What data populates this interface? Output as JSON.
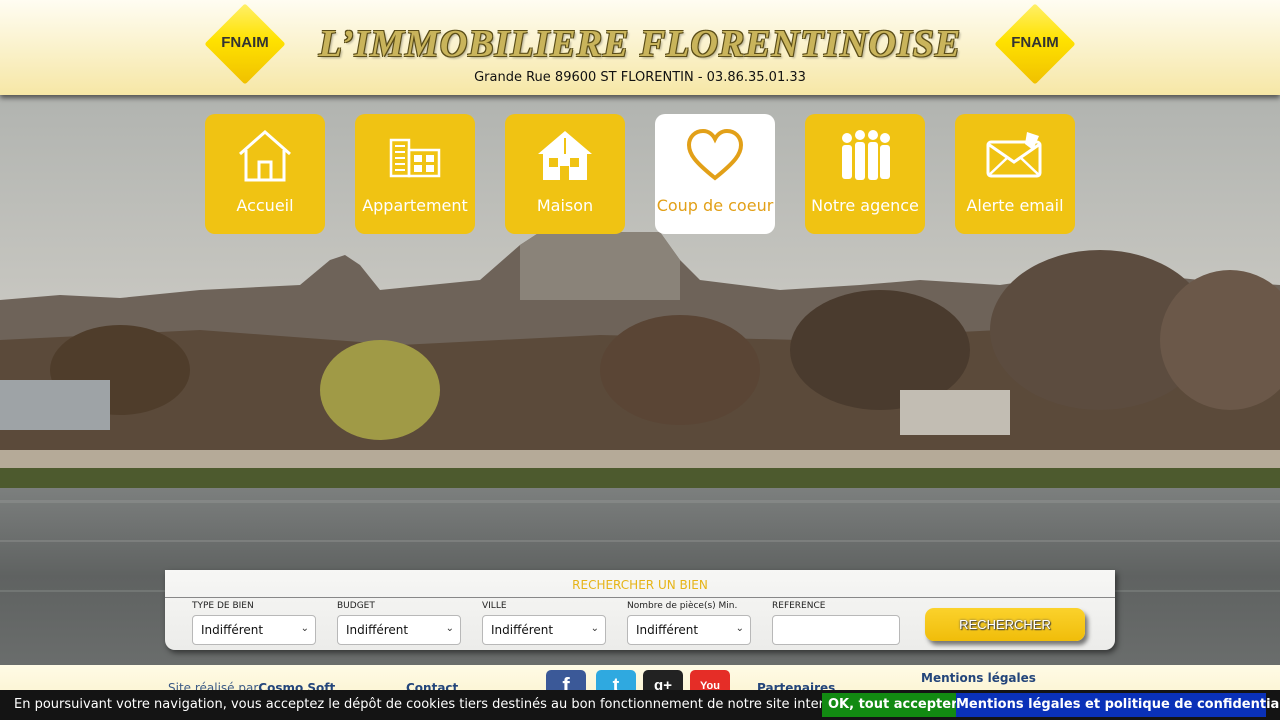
{
  "header": {
    "logo_text": "FNAIM",
    "title": "L’IMMOBILIERE FLORENTINOISE",
    "address": "Grande Rue 89600 ST FLORENTIN - 03.86.35.01.33"
  },
  "nav": {
    "items": [
      {
        "label": "Accueil",
        "icon": "house-icon",
        "active": false
      },
      {
        "label": "Appartement",
        "icon": "apartment-building-icon",
        "active": false
      },
      {
        "label": "Maison",
        "icon": "house-filled-icon",
        "active": false
      },
      {
        "label": "Coup de coeur",
        "icon": "heart-icon",
        "active": true
      },
      {
        "label": "Notre agence",
        "icon": "people-group-icon",
        "active": false
      },
      {
        "label": "Alerte email",
        "icon": "envelope-icon",
        "active": false
      }
    ]
  },
  "search": {
    "title": "RECHERCHER UN BIEN",
    "fields": [
      {
        "label": "TYPE DE BIEN",
        "value": "Indifférent"
      },
      {
        "label": "BUDGET",
        "value": "Indifférent"
      },
      {
        "label": "VILLE",
        "value": "Indifférent"
      },
      {
        "label": "Nombre de pièce(s) Min.",
        "value": "Indifférent"
      }
    ],
    "reference_label": "REFERENCE",
    "reference_value": "",
    "button_label": "RECHERCHER"
  },
  "footer": {
    "credit_prefix": "Site réalisé par",
    "credit_name": "Cosmo Soft",
    "contact": "Contact",
    "partners": "Partenaires",
    "mentions": "Mentions légales",
    "social": [
      {
        "name": "facebook-icon",
        "glyph": "f",
        "color": "#3b5998"
      },
      {
        "name": "twitter-icon",
        "glyph": "t",
        "color": "#2fa9e0"
      },
      {
        "name": "google-plus-icon",
        "glyph": "g+",
        "color": "#222222"
      },
      {
        "name": "youtube-icon",
        "glyph": "You",
        "color": "#e52d27"
      }
    ]
  },
  "cookie": {
    "text": "En poursuivant votre navigation, vous acceptez le dépôt de cookies tiers destinés au bon fonctionnement de notre site internet.",
    "ok": "OK, tout accepter.",
    "legal": "Mentions légales et politique de confidentialité"
  }
}
